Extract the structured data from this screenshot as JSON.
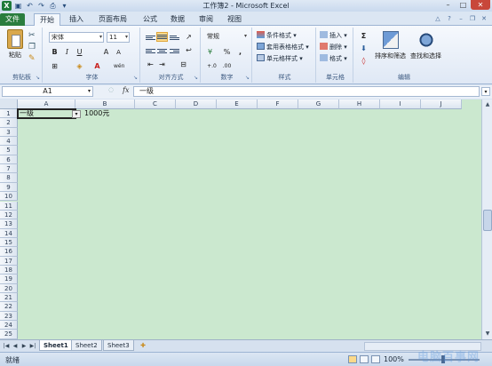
{
  "window": {
    "title": "工作簿2 - Microsoft Excel",
    "qat_icons": [
      "excel-logo-icon",
      "save-icon",
      "undo-icon",
      "redo-icon",
      "print-preview-icon",
      "customize-icon"
    ],
    "controls": [
      "minimize",
      "maximize",
      "close"
    ]
  },
  "tabs": [
    {
      "label": "文件",
      "kind": "file"
    },
    {
      "label": "开始",
      "kind": "active"
    },
    {
      "label": "插入",
      "kind": ""
    },
    {
      "label": "页面布局",
      "kind": ""
    },
    {
      "label": "公式",
      "kind": ""
    },
    {
      "label": "数据",
      "kind": ""
    },
    {
      "label": "审阅",
      "kind": ""
    },
    {
      "label": "视图",
      "kind": ""
    }
  ],
  "ribbon": {
    "clipboard": {
      "label": "剪贴板",
      "paste_label": "粘贴"
    },
    "font": {
      "label": "字体",
      "font_name": "宋体",
      "font_size": "11",
      "bold": "B",
      "italic": "I",
      "underline": "U",
      "grow": "A",
      "shrink": "A",
      "font_color": "A",
      "phonetic": "wén"
    },
    "alignment": {
      "label": "对齐方式"
    },
    "number": {
      "label": "数字",
      "format": "常规",
      "percent": "%",
      "comma": ","
    },
    "styles": {
      "label": "样式",
      "conditional": "条件格式",
      "table_format": "套用表格格式",
      "cell_styles": "单元格样式"
    },
    "cells": {
      "label": "单元格",
      "insert": "插入",
      "delete": "删除",
      "format": "格式"
    },
    "editing": {
      "label": "编辑",
      "sum": "Σ",
      "sort_filter": "排序和筛选",
      "find_select": "查找和选择"
    }
  },
  "formula_bar": {
    "name_box": "A1",
    "fx": "fx",
    "content": "一级"
  },
  "grid": {
    "columns": [
      "A",
      "B",
      "C",
      "D",
      "E",
      "F",
      "G",
      "H",
      "I",
      "J"
    ],
    "rows": [
      "1",
      "2",
      "3",
      "4",
      "5",
      "6",
      "7",
      "8",
      "9",
      "10",
      "11",
      "12",
      "13",
      "14",
      "15",
      "16",
      "17",
      "18",
      "19",
      "20",
      "21",
      "22",
      "23",
      "24",
      "25"
    ],
    "cells": {
      "A1": "一级",
      "B1": "1000元"
    }
  },
  "sheets": [
    {
      "label": "Sheet1",
      "active": true
    },
    {
      "label": "Sheet2",
      "active": false
    },
    {
      "label": "Sheet3",
      "active": false
    }
  ],
  "status": {
    "ready": "就绪",
    "zoom": "100%",
    "watermark": "电脑百事网"
  },
  "colors": {
    "grid_bg": "#cbe8cf",
    "file_tab": "#2a7d3e",
    "accent": "#fbd98a"
  }
}
